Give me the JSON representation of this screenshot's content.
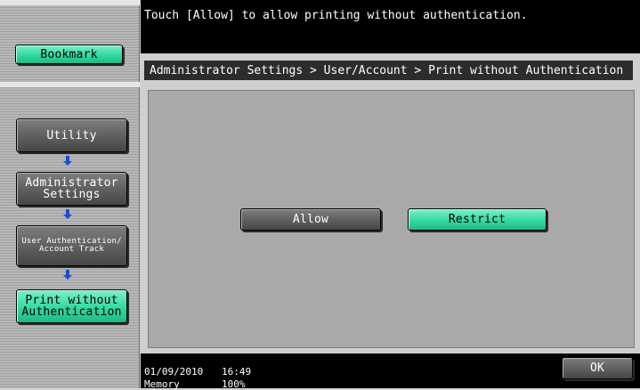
{
  "message": "Touch [Allow] to allow printing without authentication.",
  "sidebar": {
    "bookmark_label": "Bookmark",
    "nav": [
      {
        "label": "Utility"
      },
      {
        "label": "Administrator Settings"
      },
      {
        "label": "User Authentication/ Account Track"
      },
      {
        "label": "Print without Authentication"
      }
    ]
  },
  "breadcrumb": "Administrator Settings > User/Account > Print without Authentication",
  "options": {
    "allow_label": "Allow",
    "restrict_label": "Restrict",
    "selected": "Restrict"
  },
  "footer": {
    "date": "01/09/2010",
    "time": "16:49",
    "memory_label": "Memory",
    "memory_value": "100%",
    "ok_label": "OK"
  },
  "colors": {
    "selected_green": "#2fd79c",
    "unselected_gray": "#5b5b5b",
    "arrow_blue": "#1a4fd6"
  },
  "icons": [
    "down-arrow-icon"
  ]
}
